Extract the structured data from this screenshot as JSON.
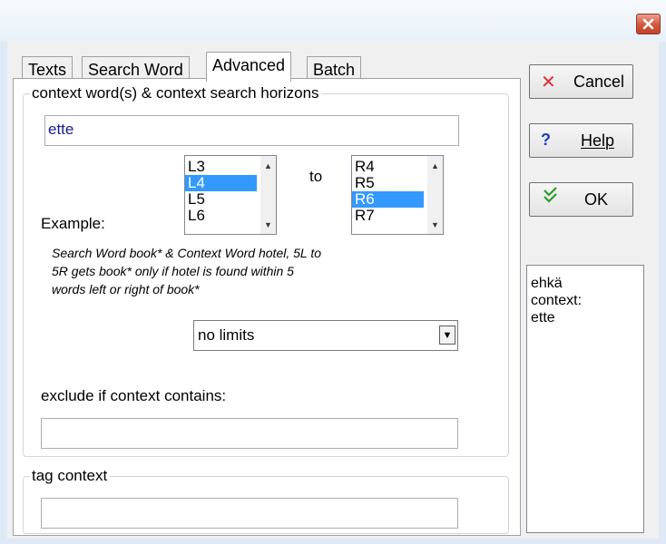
{
  "window": {
    "close_icon": "close-icon"
  },
  "tabs": [
    {
      "label": "Texts",
      "active": false
    },
    {
      "label": "Search Word",
      "active": false
    },
    {
      "label": "Advanced",
      "active": true
    },
    {
      "label": "Batch",
      "active": false
    }
  ],
  "context_group": {
    "title": "context word(s) & context search horizons",
    "context_word_value": "ette",
    "left_horizon": {
      "items": [
        "L3",
        "L4",
        "L5",
        "L6"
      ],
      "selected": "L4"
    },
    "to_label": "to",
    "right_horizon": {
      "items": [
        "R4",
        "R5",
        "R6",
        "R7"
      ],
      "selected": "R6"
    },
    "example_label": "Example:",
    "example_text_line1": "Search Word book* & Context Word hotel, 5L to",
    "example_text_line2": "5R gets book* only if hotel is found within 5",
    "example_text_line3": "words left or right of book*",
    "limit_select_value": "no limits",
    "exclude_label": "exclude if context contains:",
    "exclude_value": ""
  },
  "tag_group": {
    "title": "tag context",
    "value": ""
  },
  "buttons": {
    "cancel_label": "Cancel",
    "help_label": "Help",
    "ok_label": "OK"
  },
  "status": {
    "line1": "ehkä",
    "line2": "context:",
    "line3": "ette"
  },
  "colors": {
    "selection": "#3399ff",
    "cancel_icon": "#e03030",
    "help_icon": "#1a3fc0",
    "ok_icon": "#2a9a2a",
    "context_word_text": "#1a1a8c"
  }
}
